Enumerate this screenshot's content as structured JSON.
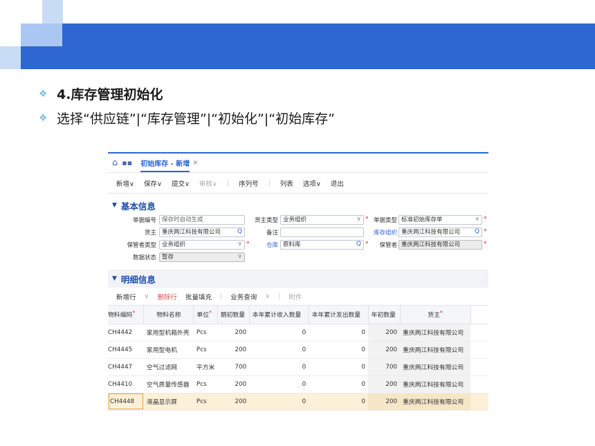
{
  "slide": {
    "heading": "4.库存管理初始化",
    "instruction": "选择“供应链”|“库存管理”|“初始化”|“初始库存”"
  },
  "app": {
    "tab_title": "初始库存 - 新增",
    "tab_close": "×",
    "toolbar": {
      "new": "新增∨",
      "save": "保存∨",
      "submit": "提交∨",
      "audit": "审核∨",
      "serial": "序列号",
      "list": "列表",
      "options": "选项∨",
      "exit": "退出"
    },
    "basic_section": {
      "title": "基本信息",
      "fields": {
        "doc_no_label": "单据编号",
        "doc_no_placeholder": "保存时自动生成",
        "owner_type_label": "货主类型",
        "owner_type_value": "业务组织",
        "doc_type_label": "单据类型",
        "doc_type_value": "标准初始库存单",
        "owner_label": "货主",
        "owner_value": "重庆两江科技有限公司",
        "remark_label": "备注",
        "remark_value": "",
        "stock_org_label": "库存组织",
        "stock_org_value": "重庆两江科技有限公司",
        "keeper_type_label": "保管者类型",
        "keeper_type_value": "业务组织",
        "warehouse_label": "仓库",
        "warehouse_value": "原料库",
        "keeper_label": "保管者",
        "keeper_value": "重庆两江科技有限公司",
        "status_label": "数据状态",
        "status_value": "暂存"
      }
    },
    "detail_section": {
      "title": "明细信息",
      "toolbar": {
        "add_row": "新增行",
        "delete_row": "删除行",
        "batch_fill": "批量填充",
        "business_query": "业务查询",
        "attachment": "附件"
      },
      "columns": [
        "物料编码",
        "物料名称",
        "单位",
        "期初数量",
        "本年累计收入数量",
        "本年累计发出数量",
        "年初数量",
        "货主"
      ],
      "rows": [
        {
          "idx": "1",
          "code": "CH4442",
          "name": "家用型机箱外壳",
          "unit": "Pcs",
          "opening": "200",
          "in": "0",
          "out": "0",
          "year_begin": "200",
          "owner": "重庆两江科技有限公司"
        },
        {
          "idx": "2",
          "code": "CH4445",
          "name": "家用型电机",
          "unit": "Pcs",
          "opening": "200",
          "in": "0",
          "out": "0",
          "year_begin": "200",
          "owner": "重庆两江科技有限公司"
        },
        {
          "idx": "3",
          "code": "CH4447",
          "name": "空气过滤网",
          "unit": "平方米",
          "opening": "700",
          "in": "0",
          "out": "0",
          "year_begin": "700",
          "owner": "重庆两江科技有限公司"
        },
        {
          "idx": "4",
          "code": "CH4410",
          "name": "空气质量传感器",
          "unit": "Pcs",
          "opening": "200",
          "in": "0",
          "out": "0",
          "year_begin": "200",
          "owner": "重庆两江科技有限公司"
        },
        {
          "idx": "5",
          "code": "CH4448",
          "name": "液晶显示屏",
          "unit": "Pcs",
          "opening": "200",
          "in": "0",
          "out": "0",
          "year_begin": "200",
          "owner": "重庆两江科技有限公司"
        }
      ]
    }
  }
}
